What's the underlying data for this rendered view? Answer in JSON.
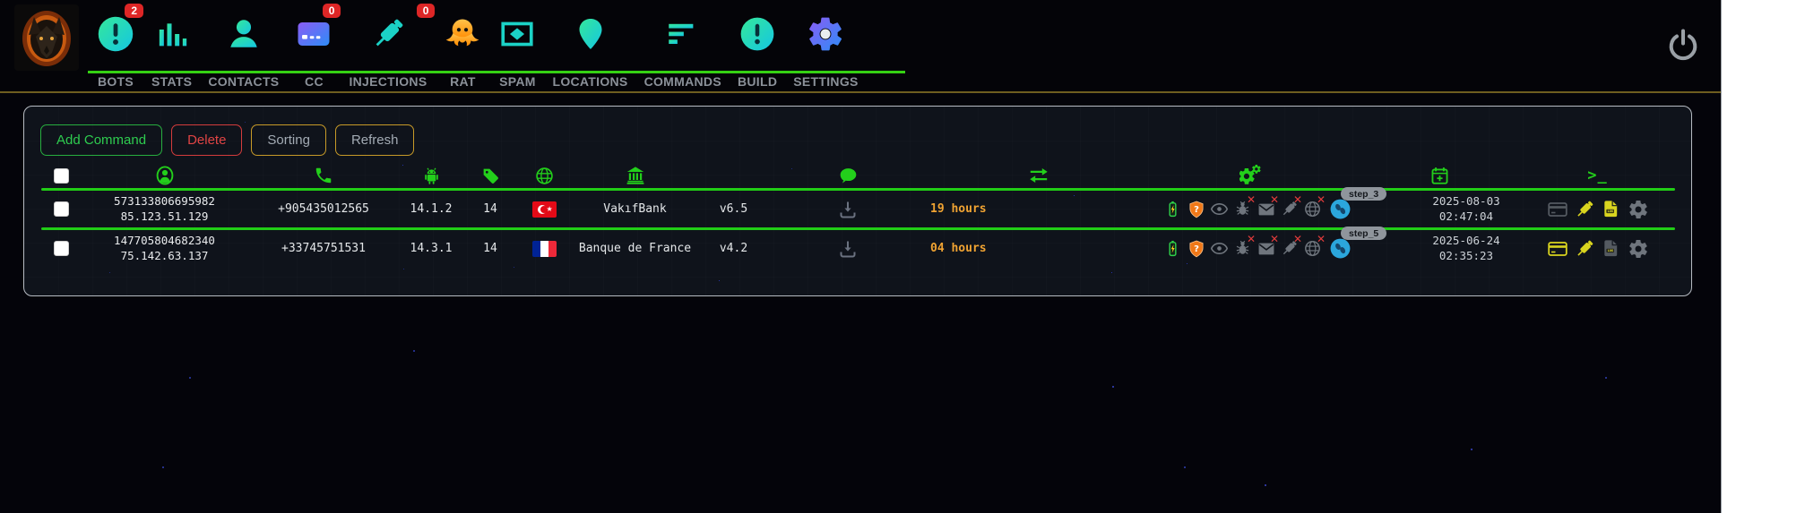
{
  "brand": {
    "logo": "wolf-flame-logo"
  },
  "nav": {
    "items": [
      {
        "label": "BOTS",
        "badge": "2",
        "icon": "alert-circle"
      },
      {
        "label": "STATS",
        "icon": "bar-chart"
      },
      {
        "label": "CONTACTS",
        "icon": "person"
      },
      {
        "label": "CC",
        "badge": "0",
        "icon": "credit-card"
      },
      {
        "label": "INJECTIONS",
        "badge": "0",
        "icon": "syringe"
      },
      {
        "label": "RAT",
        "icon": "octopus"
      },
      {
        "label": "SPAM",
        "icon": "mail-diamond"
      },
      {
        "label": "LOCATIONS",
        "icon": "map-pin"
      },
      {
        "label": "COMMANDS",
        "icon": "filter-bars"
      },
      {
        "label": "BUILD",
        "icon": "alert-circle"
      },
      {
        "label": "SETTINGS",
        "icon": "gear"
      }
    ]
  },
  "toolbar": {
    "add": "Add Command",
    "delete": "Delete",
    "sorting": "Sorting",
    "refresh": "Refresh"
  },
  "table": {
    "header_icons": [
      "checkbox",
      "user-circle",
      "phone",
      "android",
      "tag",
      "globe",
      "bank",
      "chat-bubble",
      "transfer-arrows",
      "gears",
      "calendar-plus",
      "terminal"
    ],
    "header_terminal": ">_",
    "rows": [
      {
        "id": "573133806695982",
        "ip": "85.123.51.129",
        "phone": "+905435012565",
        "android_version": "14.1.2",
        "sdk": "14",
        "country": "TR",
        "bank": "VakıfBank",
        "inject_version": "v6.5",
        "last_seen": "19 hours",
        "step": "step_3",
        "date": "2025-08-03",
        "time": "02:47:04"
      },
      {
        "id": "147705804682340",
        "ip": "75.142.63.137",
        "phone": "+33745751531",
        "android_version": "14.3.1",
        "sdk": "14",
        "country": "FR",
        "bank": "Banque de France",
        "inject_version": "v4.2",
        "last_seen": "04 hours",
        "step": "step_5",
        "date": "2025-06-24",
        "time": "02:35:23"
      }
    ]
  },
  "colors": {
    "accent_green": "#21cd16",
    "accent_teal": "#1ed4c2",
    "accent_gold": "#c79a28",
    "hours_orange": "#f0a332",
    "badge_red": "#dd2626",
    "panel_bg": "#0f131b"
  }
}
